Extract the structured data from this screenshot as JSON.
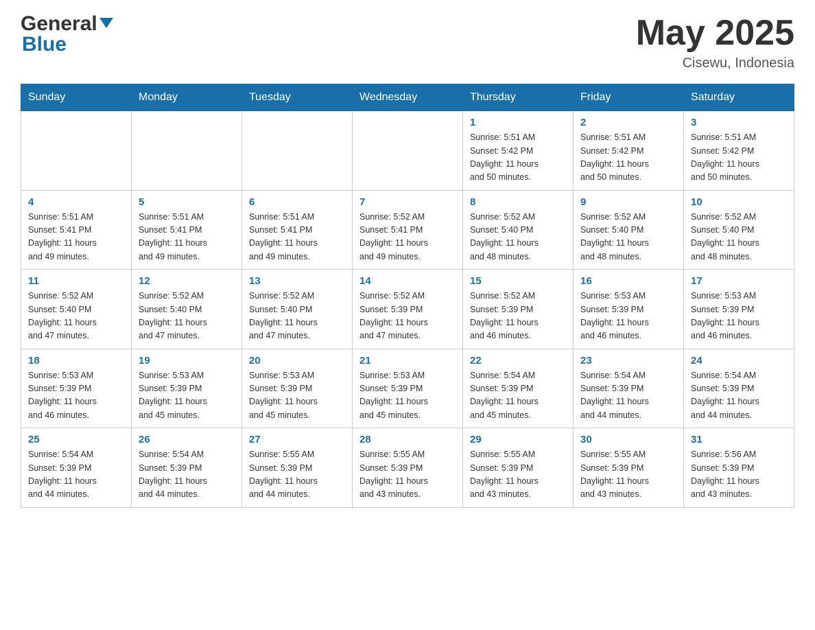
{
  "header": {
    "logo_line1": "General",
    "logo_line2": "Blue",
    "title": "May 2025",
    "subtitle": "Cisewu, Indonesia"
  },
  "days_of_week": [
    "Sunday",
    "Monday",
    "Tuesday",
    "Wednesday",
    "Thursday",
    "Friday",
    "Saturday"
  ],
  "weeks": [
    {
      "days": [
        {
          "number": "",
          "info": ""
        },
        {
          "number": "",
          "info": ""
        },
        {
          "number": "",
          "info": ""
        },
        {
          "number": "",
          "info": ""
        },
        {
          "number": "1",
          "info": "Sunrise: 5:51 AM\nSunset: 5:42 PM\nDaylight: 11 hours\nand 50 minutes."
        },
        {
          "number": "2",
          "info": "Sunrise: 5:51 AM\nSunset: 5:42 PM\nDaylight: 11 hours\nand 50 minutes."
        },
        {
          "number": "3",
          "info": "Sunrise: 5:51 AM\nSunset: 5:42 PM\nDaylight: 11 hours\nand 50 minutes."
        }
      ]
    },
    {
      "days": [
        {
          "number": "4",
          "info": "Sunrise: 5:51 AM\nSunset: 5:41 PM\nDaylight: 11 hours\nand 49 minutes."
        },
        {
          "number": "5",
          "info": "Sunrise: 5:51 AM\nSunset: 5:41 PM\nDaylight: 11 hours\nand 49 minutes."
        },
        {
          "number": "6",
          "info": "Sunrise: 5:51 AM\nSunset: 5:41 PM\nDaylight: 11 hours\nand 49 minutes."
        },
        {
          "number": "7",
          "info": "Sunrise: 5:52 AM\nSunset: 5:41 PM\nDaylight: 11 hours\nand 49 minutes."
        },
        {
          "number": "8",
          "info": "Sunrise: 5:52 AM\nSunset: 5:40 PM\nDaylight: 11 hours\nand 48 minutes."
        },
        {
          "number": "9",
          "info": "Sunrise: 5:52 AM\nSunset: 5:40 PM\nDaylight: 11 hours\nand 48 minutes."
        },
        {
          "number": "10",
          "info": "Sunrise: 5:52 AM\nSunset: 5:40 PM\nDaylight: 11 hours\nand 48 minutes."
        }
      ]
    },
    {
      "days": [
        {
          "number": "11",
          "info": "Sunrise: 5:52 AM\nSunset: 5:40 PM\nDaylight: 11 hours\nand 47 minutes."
        },
        {
          "number": "12",
          "info": "Sunrise: 5:52 AM\nSunset: 5:40 PM\nDaylight: 11 hours\nand 47 minutes."
        },
        {
          "number": "13",
          "info": "Sunrise: 5:52 AM\nSunset: 5:40 PM\nDaylight: 11 hours\nand 47 minutes."
        },
        {
          "number": "14",
          "info": "Sunrise: 5:52 AM\nSunset: 5:39 PM\nDaylight: 11 hours\nand 47 minutes."
        },
        {
          "number": "15",
          "info": "Sunrise: 5:52 AM\nSunset: 5:39 PM\nDaylight: 11 hours\nand 46 minutes."
        },
        {
          "number": "16",
          "info": "Sunrise: 5:53 AM\nSunset: 5:39 PM\nDaylight: 11 hours\nand 46 minutes."
        },
        {
          "number": "17",
          "info": "Sunrise: 5:53 AM\nSunset: 5:39 PM\nDaylight: 11 hours\nand 46 minutes."
        }
      ]
    },
    {
      "days": [
        {
          "number": "18",
          "info": "Sunrise: 5:53 AM\nSunset: 5:39 PM\nDaylight: 11 hours\nand 46 minutes."
        },
        {
          "number": "19",
          "info": "Sunrise: 5:53 AM\nSunset: 5:39 PM\nDaylight: 11 hours\nand 45 minutes."
        },
        {
          "number": "20",
          "info": "Sunrise: 5:53 AM\nSunset: 5:39 PM\nDaylight: 11 hours\nand 45 minutes."
        },
        {
          "number": "21",
          "info": "Sunrise: 5:53 AM\nSunset: 5:39 PM\nDaylight: 11 hours\nand 45 minutes."
        },
        {
          "number": "22",
          "info": "Sunrise: 5:54 AM\nSunset: 5:39 PM\nDaylight: 11 hours\nand 45 minutes."
        },
        {
          "number": "23",
          "info": "Sunrise: 5:54 AM\nSunset: 5:39 PM\nDaylight: 11 hours\nand 44 minutes."
        },
        {
          "number": "24",
          "info": "Sunrise: 5:54 AM\nSunset: 5:39 PM\nDaylight: 11 hours\nand 44 minutes."
        }
      ]
    },
    {
      "days": [
        {
          "number": "25",
          "info": "Sunrise: 5:54 AM\nSunset: 5:39 PM\nDaylight: 11 hours\nand 44 minutes."
        },
        {
          "number": "26",
          "info": "Sunrise: 5:54 AM\nSunset: 5:39 PM\nDaylight: 11 hours\nand 44 minutes."
        },
        {
          "number": "27",
          "info": "Sunrise: 5:55 AM\nSunset: 5:39 PM\nDaylight: 11 hours\nand 44 minutes."
        },
        {
          "number": "28",
          "info": "Sunrise: 5:55 AM\nSunset: 5:39 PM\nDaylight: 11 hours\nand 43 minutes."
        },
        {
          "number": "29",
          "info": "Sunrise: 5:55 AM\nSunset: 5:39 PM\nDaylight: 11 hours\nand 43 minutes."
        },
        {
          "number": "30",
          "info": "Sunrise: 5:55 AM\nSunset: 5:39 PM\nDaylight: 11 hours\nand 43 minutes."
        },
        {
          "number": "31",
          "info": "Sunrise: 5:56 AM\nSunset: 5:39 PM\nDaylight: 11 hours\nand 43 minutes."
        }
      ]
    }
  ]
}
